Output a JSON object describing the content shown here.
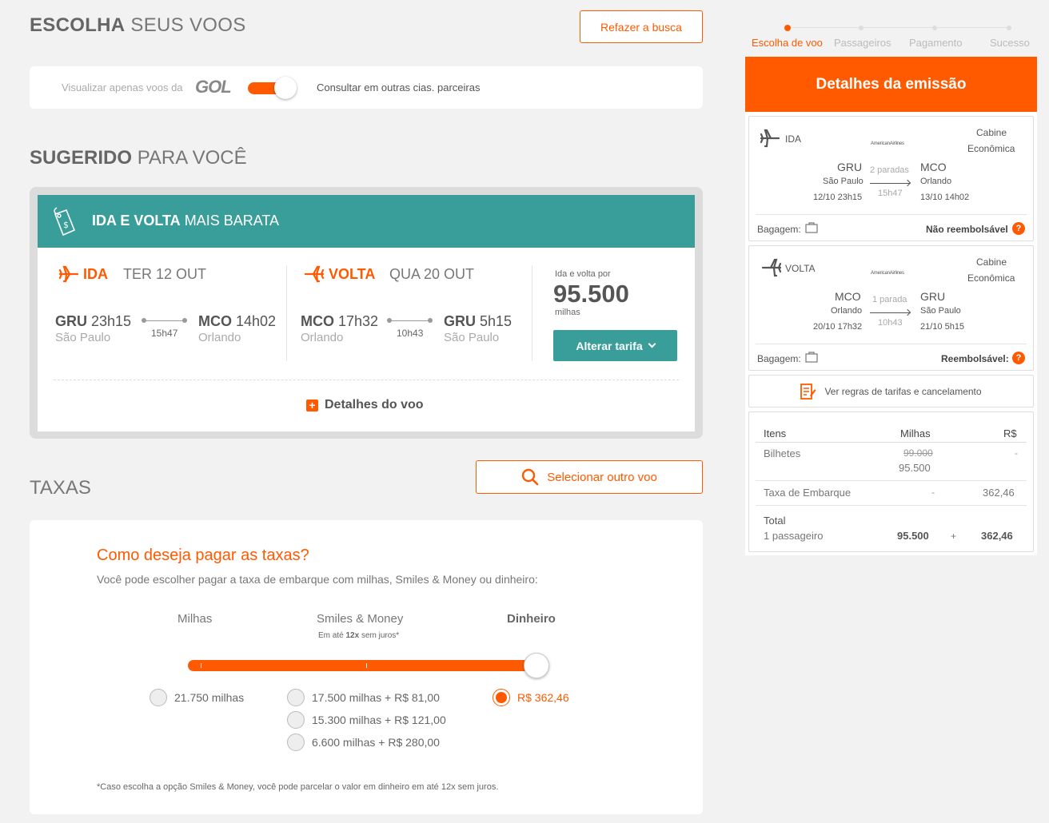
{
  "header": {
    "title_bold": "ESCOLHA",
    "title_rest": "SEUS VOOS",
    "redo_button": "Refazer a busca"
  },
  "filter": {
    "left_label": "Visualizar apenas voos da",
    "brand": "GOL",
    "right_label": "Consultar em outras cias. parceiras",
    "toggle_on": true
  },
  "suggested": {
    "title_bold": "SUGERIDO",
    "title_rest": "PARA VOCÊ",
    "banner_bold": "IDA E VOLTA",
    "banner_rest": "MAIS BARATA",
    "outbound": {
      "label": "IDA",
      "date": "TER 12 OUT",
      "from_code": "GRU",
      "from_time": "23h15",
      "from_city": "São Paulo",
      "duration": "15h47",
      "to_code": "MCO",
      "to_time": "14h02",
      "to_city": "Orlando"
    },
    "return": {
      "label": "VOLTA",
      "date": "QUA 20 OUT",
      "from_code": "MCO",
      "from_time": "17h32",
      "from_city": "Orlando",
      "duration": "10h43",
      "to_code": "GRU",
      "to_time": "5h15",
      "to_city": "São Paulo"
    },
    "price_label": "Ida e volta por",
    "price": "95.500",
    "price_unit": "milhas",
    "change_fare_button": "Alterar tarifa",
    "details_link": "Detalhes do voo",
    "select_other_button": "Selecionar outro voo"
  },
  "taxes": {
    "title": "TAXAS",
    "question": "Como deseja pagar as taxas?",
    "subtitle": "Você pode escolher pagar a taxa de embarque com milhas, Smiles & Money ou dinheiro:",
    "col_milhas": "Milhas",
    "col_sm": "Smiles & Money",
    "col_sm_note_pre": "Em até",
    "col_sm_note_bold": "12x",
    "col_sm_note_post": "sem juros*",
    "col_cash": "Dinheiro",
    "slider_level": 1.0,
    "options_milhas": [
      "21.750 milhas"
    ],
    "options_sm": [
      "17.500 milhas + R$ 81,00",
      "15.300 milhas + R$ 121,00",
      "6.600 milhas + R$ 280,00"
    ],
    "options_cash": [
      "R$ 362,46"
    ],
    "selected": "R$ 362,46",
    "footnote": "*Caso escolha a opção Smiles & Money, você pode parcelar o valor em dinheiro em até 12x sem juros."
  },
  "steps": [
    "Escolha de voo",
    "Passageiros",
    "Pagamento",
    "Sucesso"
  ],
  "summary": {
    "title": "Detalhes da emissão",
    "ida": {
      "label": "IDA",
      "airline": "AmericanAirlines",
      "cabin_1": "Cabine",
      "cabin_2": "Econômica",
      "from_code": "GRU",
      "from_city": "São Paulo",
      "from_dt": "12/10 23h15",
      "stops": "2 paradas",
      "duration": "15h47",
      "to_code": "MCO",
      "to_city": "Orlando",
      "to_dt": "13/10 14h02",
      "baggage": "Bagagem:",
      "refund": "Não reembolsável"
    },
    "volta": {
      "label": "VOLTA",
      "airline": "AmericanAirlines",
      "cabin_1": "Cabine",
      "cabin_2": "Econômica",
      "from_code": "MCO",
      "from_city": "Orlando",
      "from_dt": "20/10 17h32",
      "stops": "1 parada",
      "duration": "10h43",
      "to_code": "GRU",
      "to_city": "São Paulo",
      "to_dt": "21/10 5h15",
      "baggage": "Bagagem:",
      "refund": "Reembolsável:"
    },
    "rules_link": "Ver regras de tarifas e cancelamento",
    "table": {
      "h_items": "Itens",
      "h_miles": "Milhas",
      "h_brl": "R$",
      "tickets_label": "Bilhetes",
      "tickets_old": "99.000",
      "tickets_miles": "95.500",
      "tickets_brl": "-",
      "tax_label": "Taxa de Embarque",
      "tax_miles": "-",
      "tax_brl": "362,46",
      "total_label": "Total",
      "pax_label": "1 passageiro",
      "total_miles": "95.500",
      "plus": "+",
      "total_brl": "362,46"
    }
  },
  "colors": {
    "accent": "#ff5a00",
    "teal": "#399e9a"
  }
}
